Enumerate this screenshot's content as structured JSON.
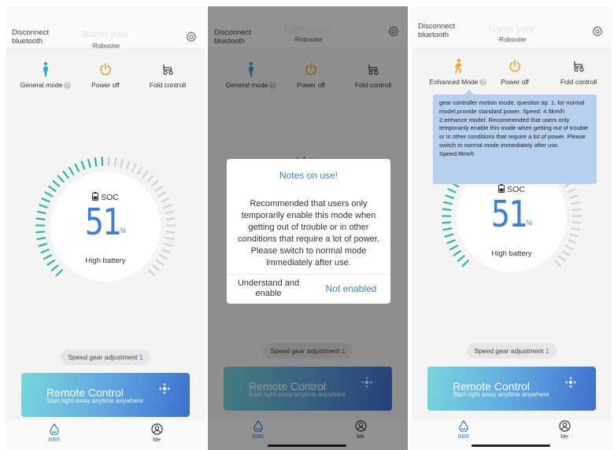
{
  "header": {
    "disconnect": "Disconnect bluetooth",
    "name_placeholder": "Name your",
    "device": "·Robooter"
  },
  "modes": {
    "general": "General mode",
    "enhanced": "Enhanced Mode",
    "power": "Power off",
    "fold": "Fold controll"
  },
  "battery": {
    "label": "SOC",
    "value": "51",
    "unit": "%",
    "status": "High battery",
    "level": 0.51
  },
  "speed": {
    "label": "Speed gear adjustment",
    "gear": "1"
  },
  "remote": {
    "title": "Remote Control",
    "subtitle": "Start right away anytime anywhere"
  },
  "tabs": {
    "home": "BBR",
    "me": "Me"
  },
  "dialog": {
    "title": "Notes on use!",
    "body": "Recommended that users only temporarily enable this mode when getting out of trouble or in other conditions that require a lot of power. Please switch to normal mode immediately after use.",
    "confirm": "Understand and enable",
    "cancel": "Not enabled"
  },
  "tooltip": {
    "line1": "gear controller motion mode, question tip: 1. for normal model,provide standard power. Speed: 4.5km/h",
    "line2": "2.enhance model: Recommended that users only temporarily enable this mode when getting out of trouble or in other conditions that require a lot of power. Please switch to normal mode immediately after use. Speed:6km/h"
  },
  "colors": {
    "accent": "#3b7fd6",
    "general_icon": "#2aa7c9",
    "power_icon": "#f2a023",
    "enhanced_icon": "#f2a023",
    "gauge_filled": "#2cb5b0",
    "gauge_empty": "#d2d2d2"
  }
}
